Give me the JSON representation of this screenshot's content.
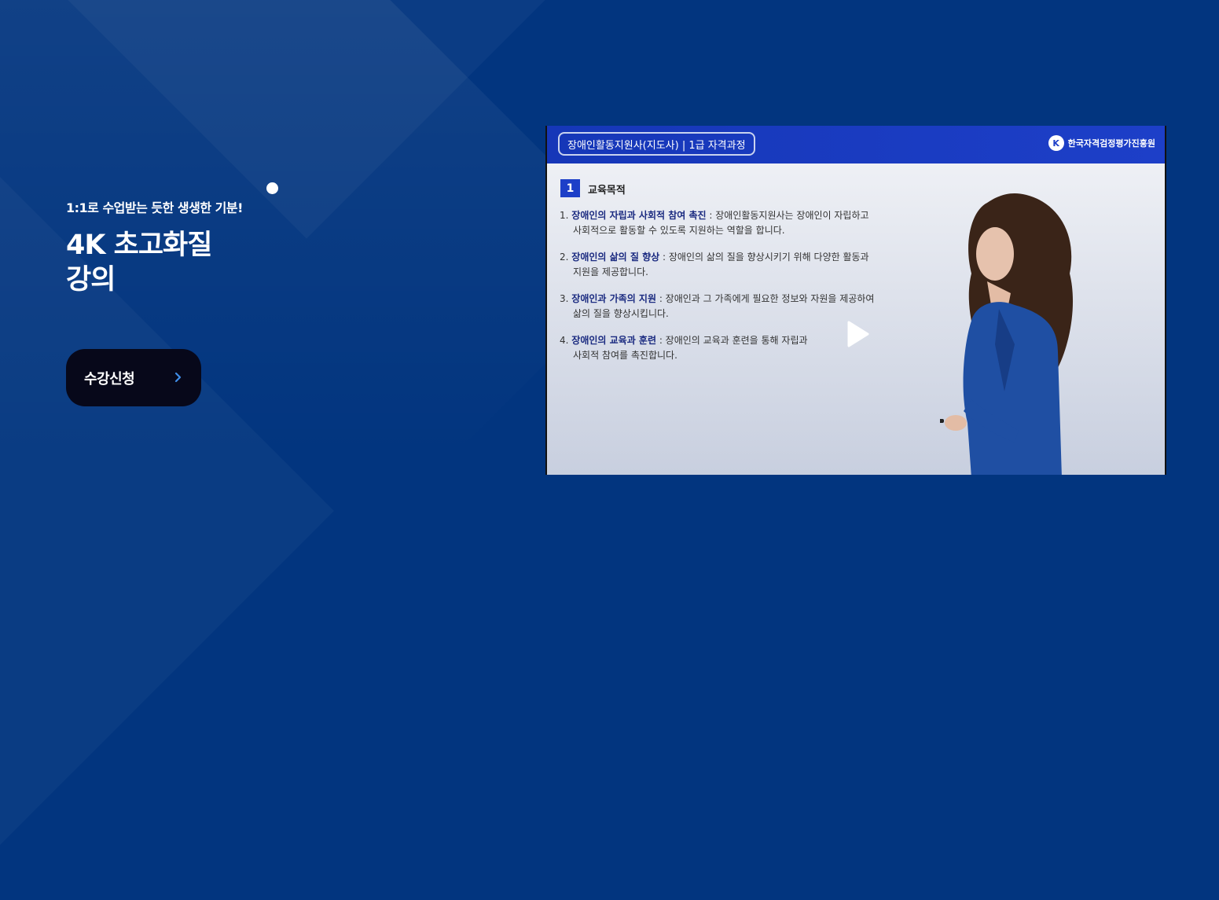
{
  "hero": {
    "subtitle": "1:1로 수업받는 듯한 생생한 기분!",
    "headline_line1": "4K 초고화질",
    "headline_line2": "강의",
    "cta_label": "수강신청"
  },
  "video": {
    "course_badge": "장애인활동지원사(지도사) | 1급 자격과정",
    "institute_name": "한국자격검정평가진흥원",
    "institute_logo_letter": "K",
    "section_number": "1",
    "section_title": "교육목적",
    "objectives": [
      {
        "num": "1.",
        "highlight": "장애인의 자립과 사회적 참여 촉진",
        "text": " : 장애인활동지원사는 장애인이 자립하고",
        "line2": "사회적으로 활동할 수 있도록 지원하는 역할을 합니다."
      },
      {
        "num": "2.",
        "highlight": "장애인의 삶의 질 향상",
        "text": " : 장애인의 삶의 질을 향상시키기 위해 다양한 활동과",
        "line2": "지원을 제공합니다."
      },
      {
        "num": "3.",
        "highlight": "장애인과 가족의 지원",
        "text": " : 장애인과 그 가족에게 필요한 정보와 자원을 제공하여",
        "line2": "삶의 질을 향상시킵니다."
      },
      {
        "num": "4.",
        "highlight": "장애인의 교육과 훈련",
        "text": " : 장애인의 교육과 훈련을 통해 자립과",
        "line2": "사회적 참여를 촉진합니다."
      }
    ]
  },
  "colors": {
    "background": "#02357f",
    "button": "#07081a",
    "chevron": "#3f8de8",
    "slide_header": "#1d3fc8"
  },
  "icons": {
    "play": "play-icon",
    "chevron": "chevron-right-icon"
  }
}
